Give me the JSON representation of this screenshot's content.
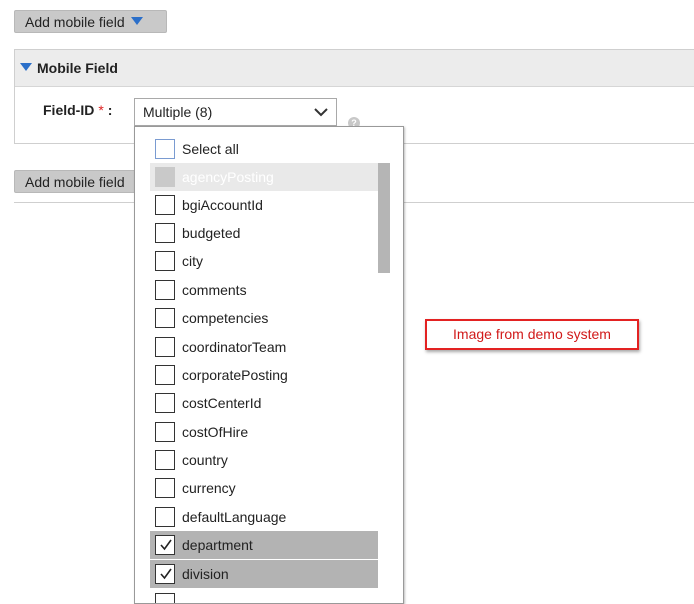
{
  "toolbar": {
    "add_mobile_field_label": "Add mobile field"
  },
  "panel": {
    "title": "Mobile Field",
    "field_label": "Field-ID",
    "required_mark": "*",
    "colon": ":"
  },
  "field_select": {
    "value": "Multiple (8)",
    "options": [
      {
        "label": "Select all",
        "checked": false,
        "disabled": false
      },
      {
        "label": "agencyPosting",
        "checked": false,
        "disabled": true
      },
      {
        "label": "bgiAccountId",
        "checked": false,
        "disabled": false
      },
      {
        "label": "budgeted",
        "checked": false,
        "disabled": false
      },
      {
        "label": "city",
        "checked": false,
        "disabled": false
      },
      {
        "label": "comments",
        "checked": false,
        "disabled": false
      },
      {
        "label": "competencies",
        "checked": false,
        "disabled": false
      },
      {
        "label": "coordinatorTeam",
        "checked": false,
        "disabled": false
      },
      {
        "label": "corporatePosting",
        "checked": false,
        "disabled": false
      },
      {
        "label": "costCenterId",
        "checked": false,
        "disabled": false
      },
      {
        "label": "costOfHire",
        "checked": false,
        "disabled": false
      },
      {
        "label": "country",
        "checked": false,
        "disabled": false
      },
      {
        "label": "currency",
        "checked": false,
        "disabled": false
      },
      {
        "label": "defaultLanguage",
        "checked": false,
        "disabled": false
      },
      {
        "label": "department",
        "checked": true,
        "disabled": false
      },
      {
        "label": "division",
        "checked": true,
        "disabled": false
      }
    ]
  },
  "annotation": {
    "text": "Image from demo system"
  },
  "colors": {
    "accent_triangle": "#2b6fc9",
    "annotation_red": "#e32222",
    "required_red": "#dd2222"
  }
}
